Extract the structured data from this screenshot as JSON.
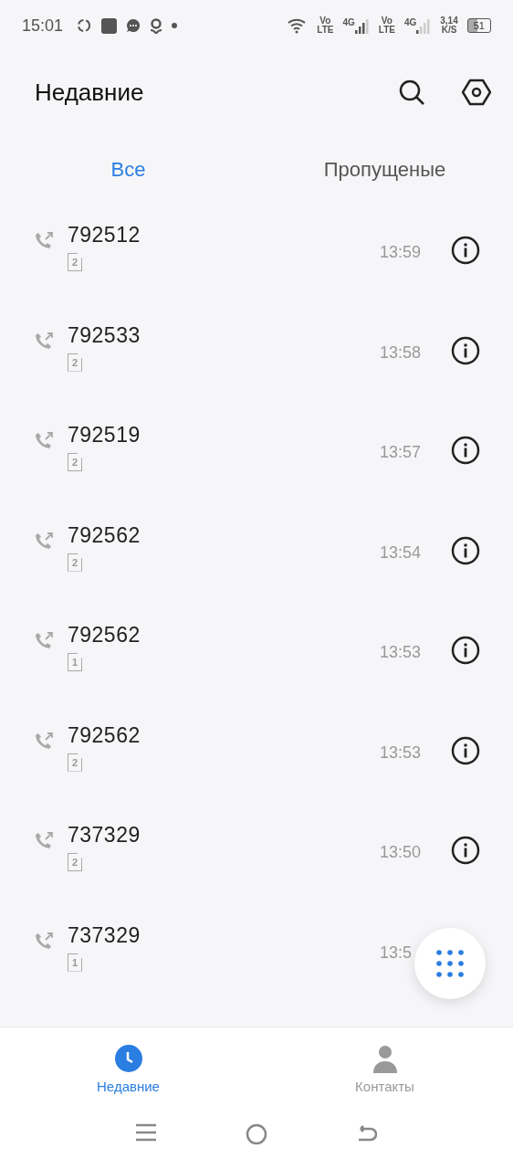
{
  "status_bar": {
    "time": "15:01",
    "network": [
      {
        "vo": "Vo",
        "lte": "LTE",
        "gen": "4G"
      },
      {
        "vo": "Vo",
        "lte": "LTE",
        "gen": "4G"
      }
    ],
    "speed_value": "3,14",
    "speed_unit": "K/S",
    "battery": "51"
  },
  "header": {
    "title": "Недавние"
  },
  "tabs": [
    {
      "label": "Все",
      "selected": true
    },
    {
      "label": "Пропущеные",
      "selected": false
    }
  ],
  "calls": [
    {
      "number": "792512",
      "sim": "2",
      "time": "13:59"
    },
    {
      "number": "792533",
      "sim": "2",
      "time": "13:58"
    },
    {
      "number": "792519",
      "sim": "2",
      "time": "13:57"
    },
    {
      "number": "792562",
      "sim": "2",
      "time": "13:54"
    },
    {
      "number": "792562",
      "sim": "1",
      "time": "13:53"
    },
    {
      "number": "792562",
      "sim": "2",
      "time": "13:53"
    },
    {
      "number": "737329",
      "sim": "2",
      "time": "13:50"
    },
    {
      "number": "737329",
      "sim": "1",
      "time": "13:5"
    }
  ],
  "bottom_nav": [
    {
      "label": "Недавние",
      "kind": "recent",
      "selected": true
    },
    {
      "label": "Контакты",
      "kind": "contacts",
      "selected": false
    }
  ]
}
